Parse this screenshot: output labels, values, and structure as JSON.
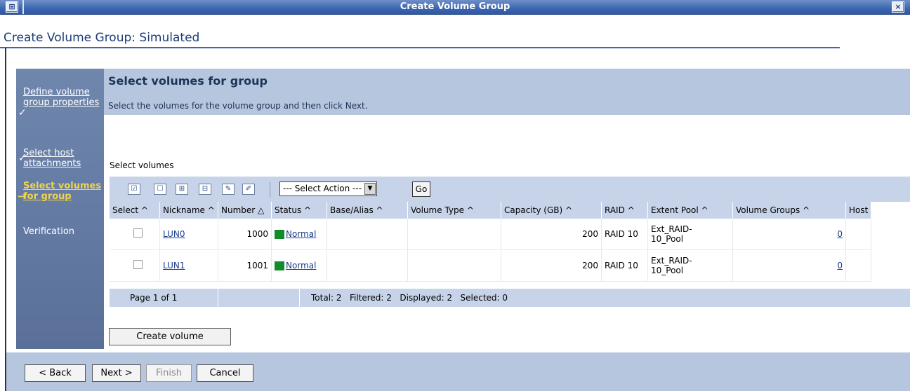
{
  "window": {
    "title": "Create Volume Group",
    "close_glyph": "×",
    "restore_glyph": "⊞"
  },
  "page_title": "Create Volume Group: Simulated",
  "wizard_steps": [
    {
      "label": "Define volume group properties",
      "state": "done"
    },
    {
      "label": "Select host attachments",
      "state": "done"
    },
    {
      "label": "Select volumes for group",
      "state": "current"
    },
    {
      "label": "Verification",
      "state": "pending"
    }
  ],
  "main": {
    "title": "Select volumes for group",
    "description": "Select the volumes for the volume group and then click Next.",
    "section_label": "Select volumes"
  },
  "toolbar": {
    "icons": [
      "select-all-icon",
      "deselect-all-icon",
      "show-filter-icon",
      "clear-filter-icon",
      "edit-sort-icon",
      "clear-sort-icon"
    ],
    "action_select": "--- Select Action ---",
    "go_label": "Go"
  },
  "table": {
    "columns": [
      "Select ^",
      "Nickname ^",
      "Number △",
      "Status ^",
      "Base/Alias ^",
      "Volume Type ^",
      "Capacity (GB) ^",
      "RAID ^",
      "Extent Pool ^",
      "Volume Groups ^",
      "Host"
    ],
    "rows": [
      {
        "nickname": "LUN0",
        "number": "1000",
        "status": "Normal",
        "base_alias": "",
        "volume_type": "",
        "capacity": "200",
        "raid": "RAID 10",
        "extent_pool_1": "Ext_RAID-",
        "extent_pool_2": "10_Pool",
        "volume_groups": "0",
        "host": ""
      },
      {
        "nickname": "LUN1",
        "number": "1001",
        "status": "Normal",
        "base_alias": "",
        "volume_type": "",
        "capacity": "200",
        "raid": "RAID 10",
        "extent_pool_1": "Ext_RAID-",
        "extent_pool_2": "10_Pool",
        "volume_groups": "0",
        "host": ""
      }
    ],
    "footer_page": "Page 1 of 1",
    "footer_totals": "Total: 2   Filtered: 2   Displayed: 2   Selected: 0"
  },
  "create_volume_label": "Create volume",
  "nav_buttons": {
    "back": "< Back",
    "next": "Next >",
    "finish": "Finish",
    "cancel": "Cancel"
  },
  "colors": {
    "title_bar": "#3d66b0",
    "header_band": "#b6c6df",
    "nav_panel": "#6f86ad",
    "status_normal": "#128c2a",
    "current_step": "#f1d44c"
  }
}
